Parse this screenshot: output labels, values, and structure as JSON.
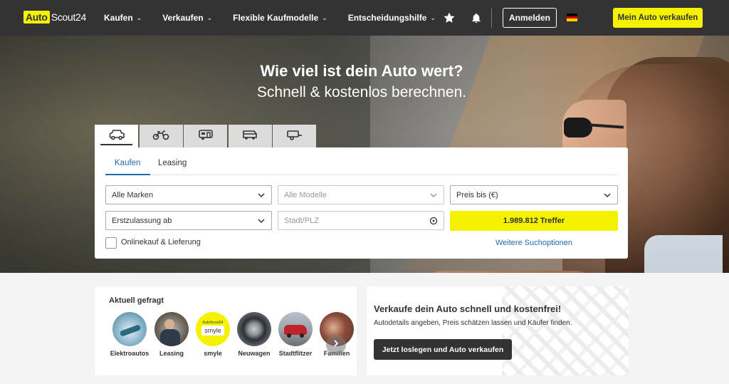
{
  "header": {
    "logo_auto": "Auto",
    "logo_scout": "Scout24",
    "nav": [
      {
        "label": "Kaufen"
      },
      {
        "label": "Verkaufen"
      },
      {
        "label": "Flexible Kaufmodelle"
      },
      {
        "label": "Entscheidungshilfe"
      }
    ],
    "login_label": "Anmelden",
    "sell_label": "Mein Auto verkaufen"
  },
  "hero": {
    "title": "Wie viel ist dein Auto wert?",
    "subtitle": "Schnell & kostenlos berechnen."
  },
  "vehicle_tabs": [
    {
      "icon": "car-icon",
      "active": true
    },
    {
      "icon": "motorcycle-icon",
      "active": false
    },
    {
      "icon": "caravan-icon",
      "active": false
    },
    {
      "icon": "van-icon",
      "active": false
    },
    {
      "icon": "trailer-icon",
      "active": false
    }
  ],
  "search": {
    "tabs": [
      {
        "label": "Kaufen"
      },
      {
        "label": "Leasing"
      }
    ],
    "make": "Alle Marken",
    "model": "Alle Modelle",
    "price": "Preis bis (€)",
    "registration": "Erstzulassung ab",
    "location_placeholder": "Stadt/PLZ",
    "results_label": "1.989.812 Treffer",
    "online_label": "Onlinekauf & Lieferung",
    "more_options": "Weitere Suchoptionen"
  },
  "popular": {
    "title": "Aktuell gefragt",
    "items": [
      {
        "label": "Elektroautos"
      },
      {
        "label": "Leasing"
      },
      {
        "label": "smyle",
        "badge_top": "AutoScout24",
        "badge_text": "smyle"
      },
      {
        "label": "Neuwagen"
      },
      {
        "label": "Stadtflitzer"
      },
      {
        "label": "Familien"
      }
    ]
  },
  "sell_card": {
    "title": "Verkaufe dein Auto schnell und kostenfrei!",
    "text": "Autodetails angeben, Preis schätzen lassen und Käufer finden.",
    "button": "Jetzt loslegen und Auto verkaufen"
  },
  "colors": {
    "header_bg": "#333333",
    "brand_yellow": "#f5f200",
    "link_blue": "#1f6bb0"
  }
}
